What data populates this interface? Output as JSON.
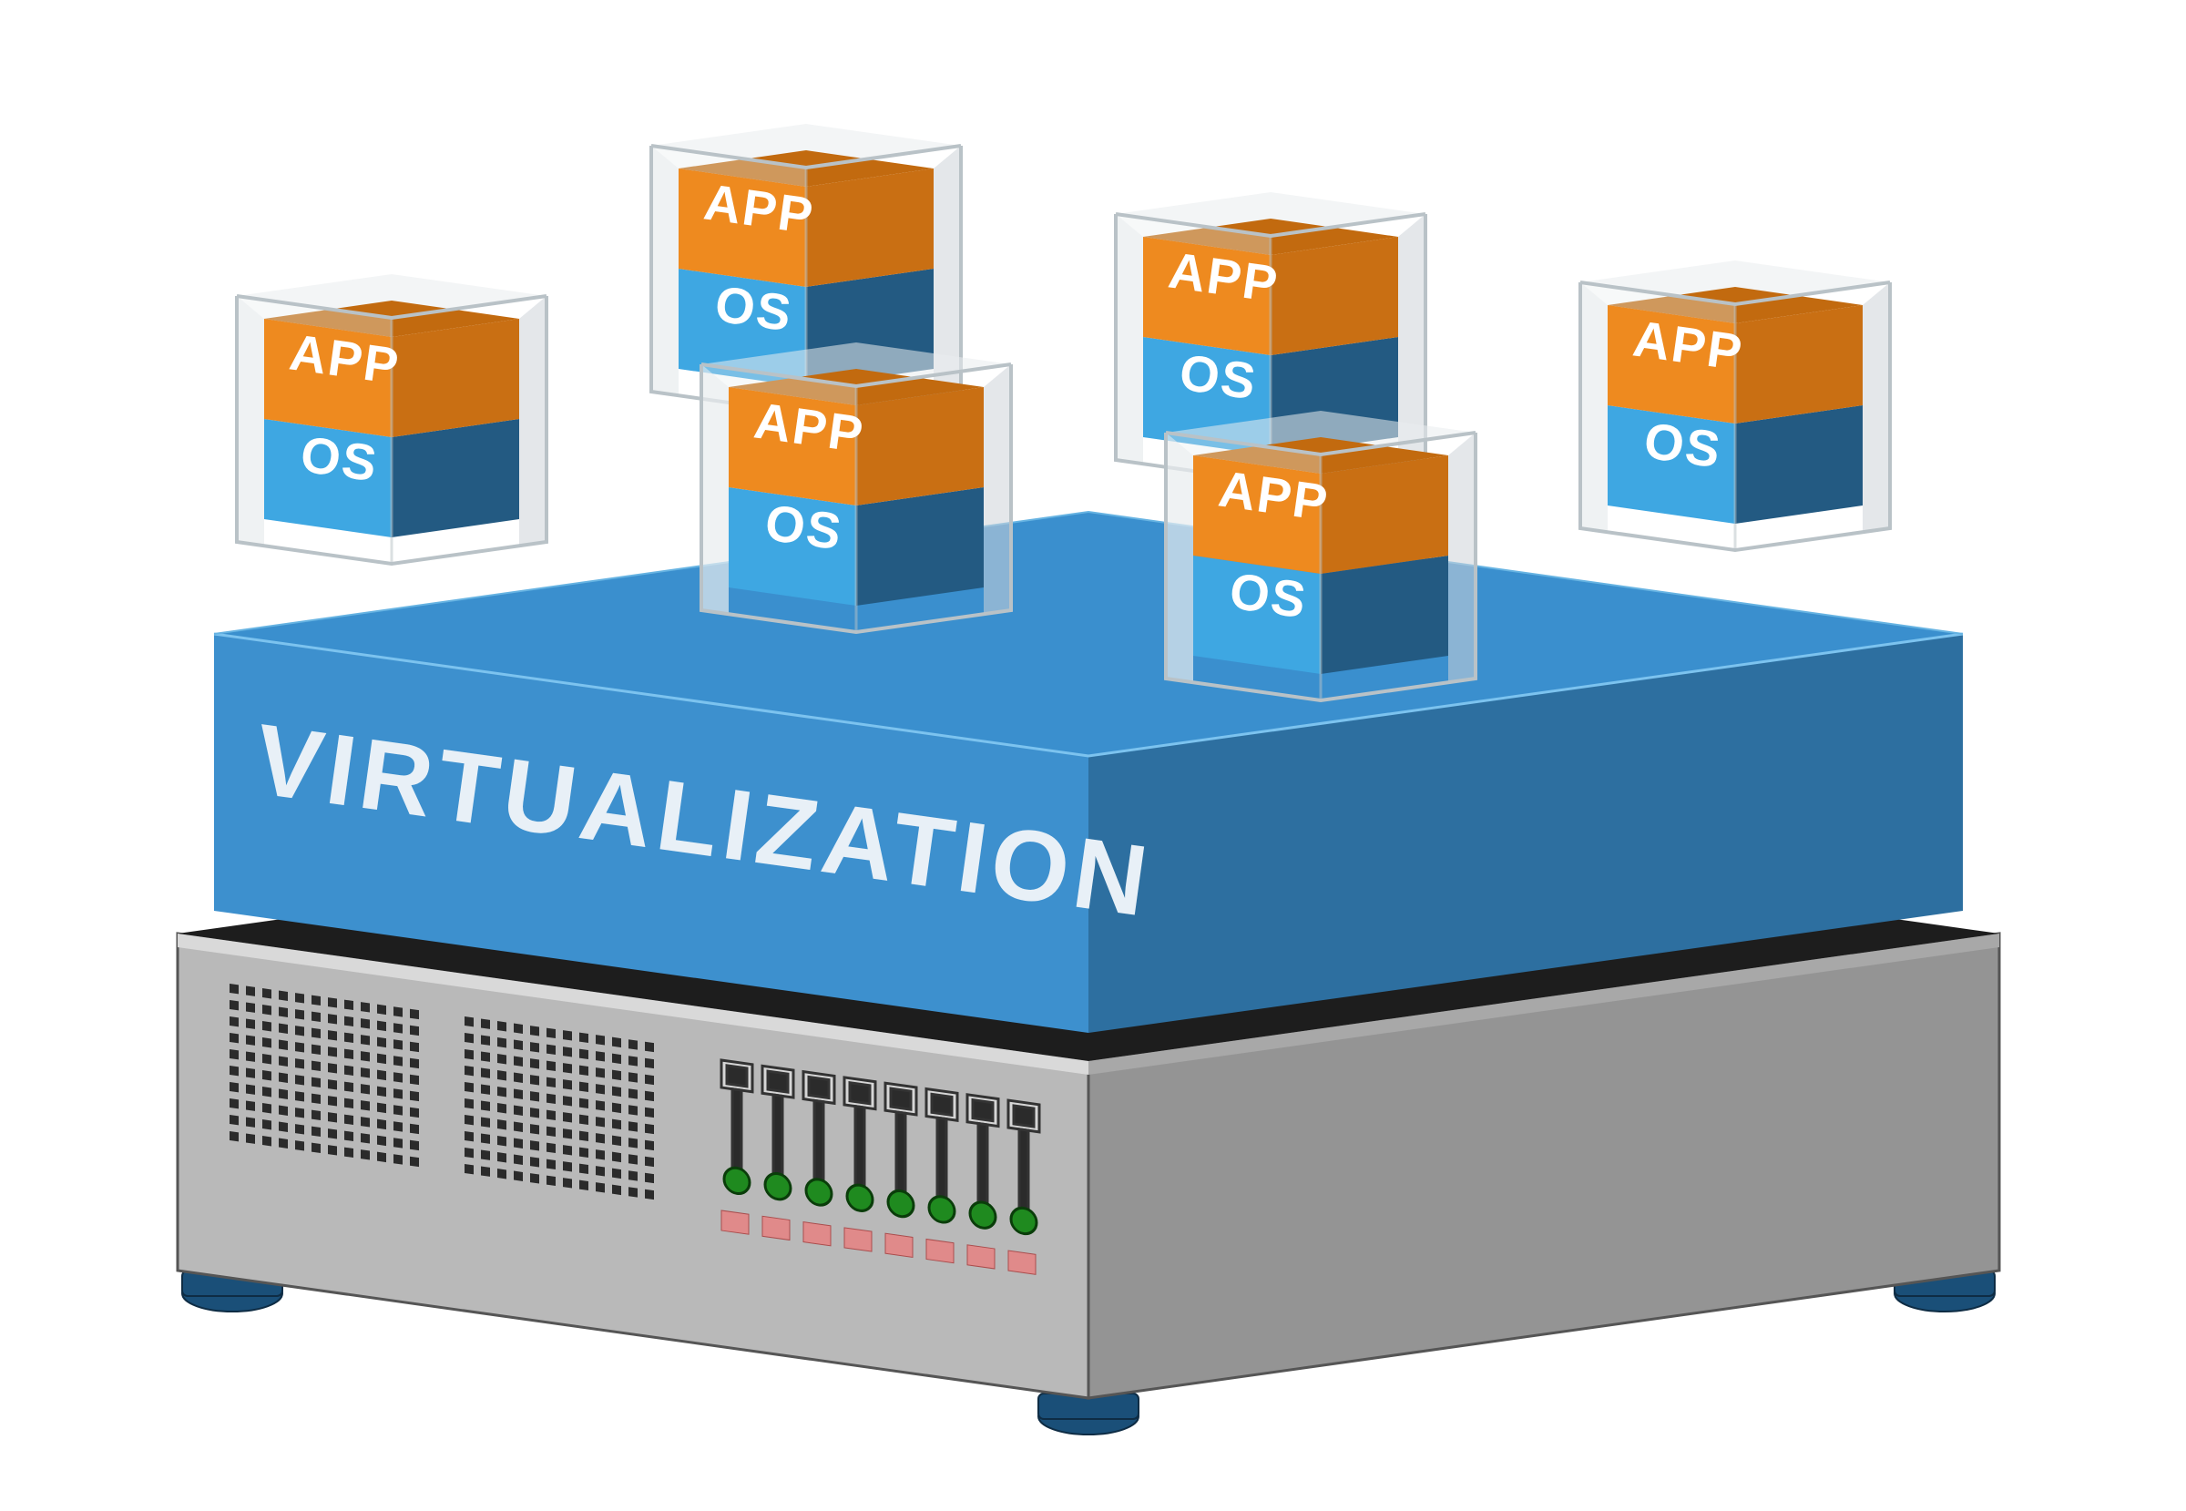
{
  "diagram": {
    "platform_label": "VIRTUALIZATION",
    "vm_top_label": "APP",
    "vm_bottom_label": "OS",
    "vm_count": 6,
    "drive_bays": 8,
    "status_leds": 8,
    "colors": {
      "server_body": "#b9b9b9",
      "server_side": "#949494",
      "server_top_dark": "#1d1d1d",
      "virt_top": "#3a8fce",
      "virt_front": "#3d90ce",
      "virt_side": "#2d6fa0",
      "vm_app": "#ee8a1f",
      "vm_app_top": "#c26a0f",
      "vm_os_front": "#3ea7e2",
      "vm_os_side": "#235a82",
      "glass": "#e9edef",
      "led_green": "#1f8a1f",
      "led_red": "#e08a8a",
      "foot": "#1a4f78"
    }
  }
}
